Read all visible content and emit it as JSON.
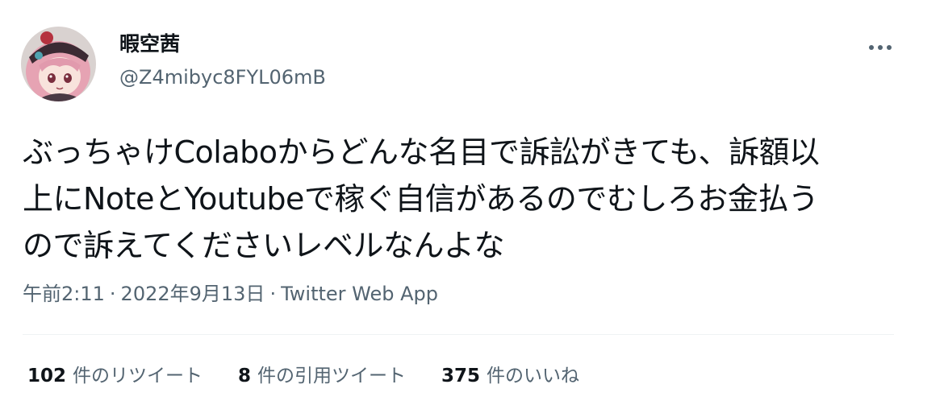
{
  "author": {
    "display_name": "暇空茜",
    "handle": "@Z4mibyc8FYL06mB",
    "avatar_icon": "anime-girl-avatar"
  },
  "more_icon": "more-horizontal-icon",
  "tweet": {
    "lines": [
      "ぶっちゃけColaboからどんな名目で訴訟がきても、訴額以",
      "上にNoteとYoutubeで稼ぐ自信があるのでむしろお金払う",
      "ので訴えてくださいレベルなんよな"
    ]
  },
  "meta": {
    "time": "午前2:11",
    "separator": "·",
    "date": "2022年9月13日",
    "source": "Twitter Web App"
  },
  "stats": {
    "retweets": {
      "count": "102",
      "label": "件のリツイート"
    },
    "quotes": {
      "count": "8",
      "label": "件の引用ツイート"
    },
    "likes": {
      "count": "375",
      "label": "件のいいね"
    }
  },
  "colors": {
    "text": "#0f1419",
    "secondary": "#536471",
    "divider": "#eff3f4"
  }
}
